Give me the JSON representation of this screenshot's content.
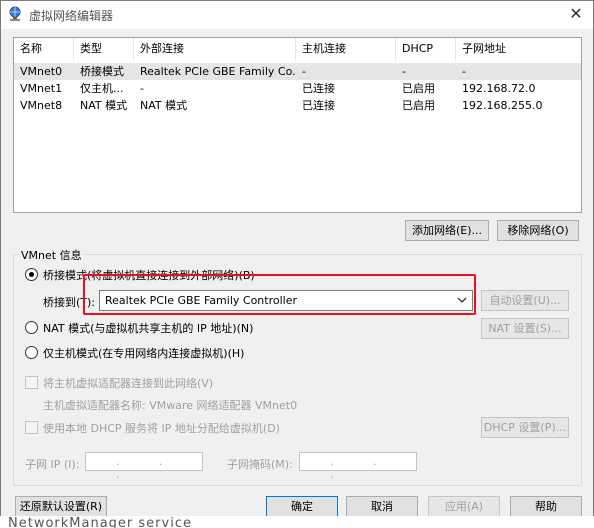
{
  "window": {
    "title": "虚拟网络编辑器",
    "close_glyph": "✕"
  },
  "network_list": {
    "columns": [
      "名称",
      "类型",
      "外部连接",
      "主机连接",
      "DHCP",
      "子网地址"
    ],
    "rows": [
      {
        "name": "VMnet0",
        "type": "桥接模式",
        "external": "Realtek PCIe GBE Family Co...",
        "host": "-",
        "dhcp": "-",
        "subnet": "-"
      },
      {
        "name": "VMnet1",
        "type": "仅主机...",
        "external": "-",
        "host": "已连接",
        "dhcp": "已启用",
        "subnet": "192.168.72.0"
      },
      {
        "name": "VMnet8",
        "type": "NAT 模式",
        "external": "NAT 模式",
        "host": "已连接",
        "dhcp": "已启用",
        "subnet": "192.168.255.0"
      }
    ]
  },
  "buttons": {
    "add_network": "添加网络(E)...",
    "remove_network": "移除网络(O)",
    "auto_settings": "自动设置(U)...",
    "nat_settings": "NAT 设置(S)...",
    "dhcp_settings": "DHCP 设置(P)...",
    "restore_defaults": "还原默认设置(R)",
    "ok": "确定",
    "cancel": "取消",
    "apply": "应用(A)",
    "help": "帮助"
  },
  "vmnet_info": {
    "group_label": "VMnet 信息",
    "bridged_label": "桥接模式(将虚拟机直接连接到外部网络)(B)",
    "bridged_to_label": "桥接到(T):",
    "bridged_to_value": "Realtek PCIe GBE Family Controller",
    "nat_label": "NAT 模式(与虚拟机共享主机的 IP 地址)(N)",
    "host_only_label": "仅主机模式(在专用网络内连接虚拟机)(H)",
    "connect_adapter_label": "将主机虚拟适配器连接到此网络(V)",
    "adapter_name_label": "主机虚拟适配器名称: VMware 网络适配器 VMnet0",
    "use_dhcp_label": "使用本地 DHCP 服务将 IP 地址分配给虚拟机(D)",
    "subnet_ip_label": "子网 IP (I):",
    "subnet_mask_label": "子网掩码(M):",
    "ip_placeholder": ". . .",
    "selected_mode": "bridged"
  },
  "background_text": "NetworkManager service",
  "colors": {
    "highlight": "#e81123",
    "selected_row": "#e5e5e5"
  }
}
